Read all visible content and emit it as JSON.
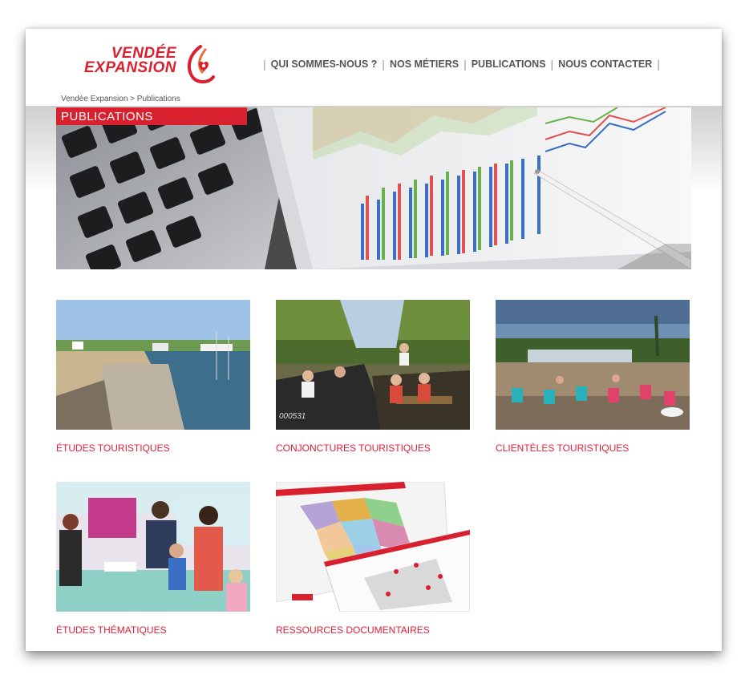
{
  "logo": {
    "line1": "VENDÉE",
    "line2": "EXPANSION"
  },
  "nav": {
    "items": [
      {
        "label": "QUI SOMMES-NOUS ?"
      },
      {
        "label": "NOS MÉTIERS"
      },
      {
        "label": "PUBLICATIONS"
      },
      {
        "label": "NOUS CONTACTER"
      }
    ],
    "separator": "|"
  },
  "breadcrumb": "Vendée Expansion > Publications",
  "hero": {
    "title": "PUBLICATIONS"
  },
  "tiles": [
    {
      "label": "ÉTUDES TOURISTIQUES",
      "image": "harbor-photo"
    },
    {
      "label": "CONJONCTURES TOURISTIQUES",
      "image": "boat-tour-photo"
    },
    {
      "label": "CLIENTÈLES TOURISTIQUES",
      "image": "beach-deckchairs-photo"
    },
    {
      "label": "ÉTUDES THÉMATIQUES",
      "image": "family-reception-photo"
    },
    {
      "label": "RESSOURCES DOCUMENTAIRES",
      "image": "maps-documents-photo"
    }
  ],
  "colors": {
    "brand_red": "#d8202e",
    "label_red": "#e0203a",
    "nav_text": "#555555"
  }
}
